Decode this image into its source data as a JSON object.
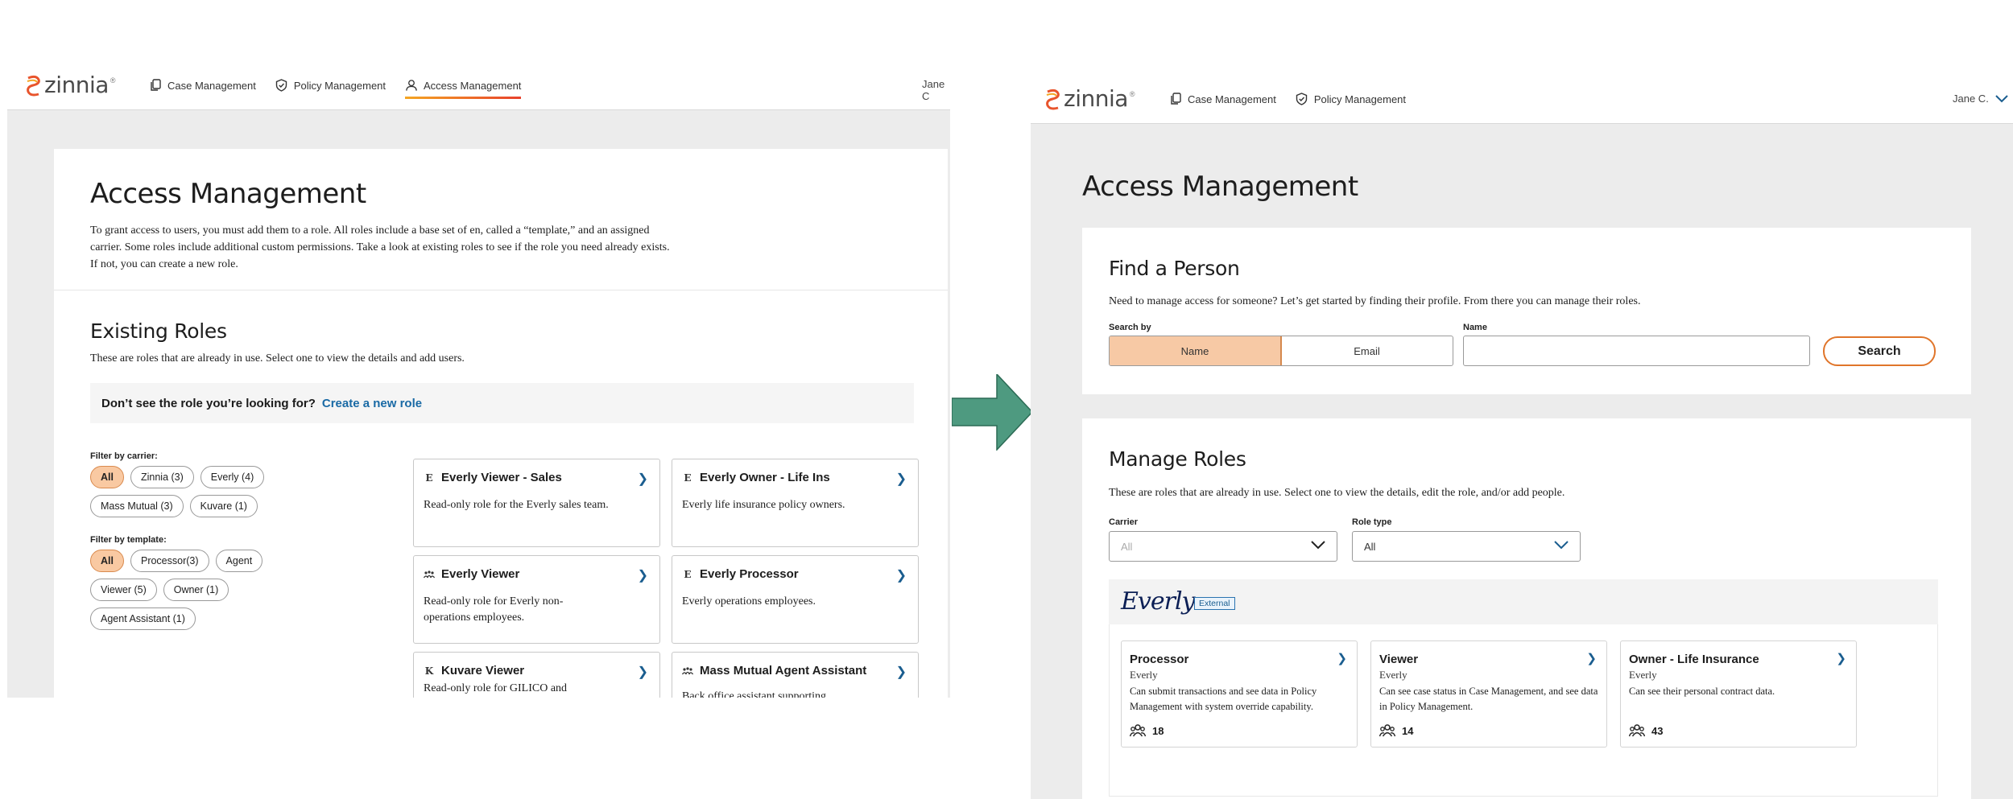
{
  "left": {
    "logo": "zinnia",
    "nav": [
      {
        "label": "Case Management",
        "icon": "copy-icon"
      },
      {
        "label": "Policy Management",
        "icon": "shield-icon"
      },
      {
        "label": "Access Management",
        "icon": "users-icon",
        "active": true
      }
    ],
    "user": "Jane C",
    "title": "Access Management",
    "intro": "To grant access to users, you must add them to a role. All roles include a base set of en, called a “template,” and an assigned carrier. Some roles include additional custom permissions. Take a look at existing roles to see if the role you need already exists. If not, you can create a new role.",
    "existing_title": "Existing Roles",
    "existing_sub": "These are roles that are already in use. Select one to view the details and add users.",
    "banner_text": "Don’t see the role you’re looking for?",
    "banner_link": "Create a new role",
    "filter_carrier_label": "Filter by carrier:",
    "carrier_chips": [
      "All",
      "Zinnia (3)",
      "Everly (4)",
      "Mass Mutual (3)",
      "Kuvare (1)"
    ],
    "filter_template_label": "Filter by template:",
    "template_chips": [
      "All",
      "Processor(3)",
      "Agent",
      "Viewer (5)",
      "Owner (1)",
      "Agent Assistant (1)"
    ],
    "roles": [
      {
        "badge": "E",
        "title": "Everly Viewer - Sales",
        "desc": "Read-only role for the Everly sales team."
      },
      {
        "badge": "E",
        "title": "Everly Owner - Life Ins",
        "desc": "Everly life insurance policy owners."
      },
      {
        "badge": "ﾊ",
        "title": "Everly Viewer",
        "desc": "Read-only role for Everly non-operations employees."
      },
      {
        "badge": "E",
        "title": "Everly Processor",
        "desc": "Everly operations employees."
      },
      {
        "badge": "K",
        "title": "Kuvare Viewer",
        "desc": "Read-only role for GILICO and"
      },
      {
        "badge": "ﾊ",
        "title": "Mass Mutual Agent Assistant",
        "desc": "Back office assistant supporting"
      }
    ]
  },
  "right": {
    "logo": "zinnia",
    "nav": [
      {
        "label": "Case Management",
        "icon": "copy-icon"
      },
      {
        "label": "Policy Management",
        "icon": "shield-icon"
      }
    ],
    "user": "Jane C.",
    "title": "Access Management",
    "find_title": "Find a Person",
    "find_sub": "Need to manage access for someone? Let’s get started by finding their profile. From there you can manage their roles.",
    "search_by_label": "Search by",
    "search_by_options": [
      "Name",
      "Email"
    ],
    "name_label": "Name",
    "name_value": "",
    "search_button": "Search",
    "manage_title": "Manage Roles",
    "manage_sub": "These are roles that are already in use. Select one to view the details, edit the role, and/or add people.",
    "carrier_label": "Carrier",
    "carrier_value": "All",
    "role_type_label": "Role type",
    "role_type_value": "All",
    "carrier_brand": "Everly",
    "external_badge": "External",
    "role_cards": [
      {
        "title": "Processor",
        "carrier": "Everly",
        "desc": "Can submit transactions and see data in Policy Management with system override capability.",
        "count": "18"
      },
      {
        "title": "Viewer",
        "carrier": "Everly",
        "desc": "Can see case status in Case Management, and see data in Policy Management.",
        "count": "14"
      },
      {
        "title": "Owner - Life Insurance",
        "carrier": "Everly",
        "desc": "Can see their personal contract data.",
        "count": "43"
      }
    ]
  },
  "colors": {
    "accent": "#e0752a",
    "selected_fill": "#f7c9a5",
    "link": "#1a6aa5",
    "arrow": "#4e9a80"
  }
}
